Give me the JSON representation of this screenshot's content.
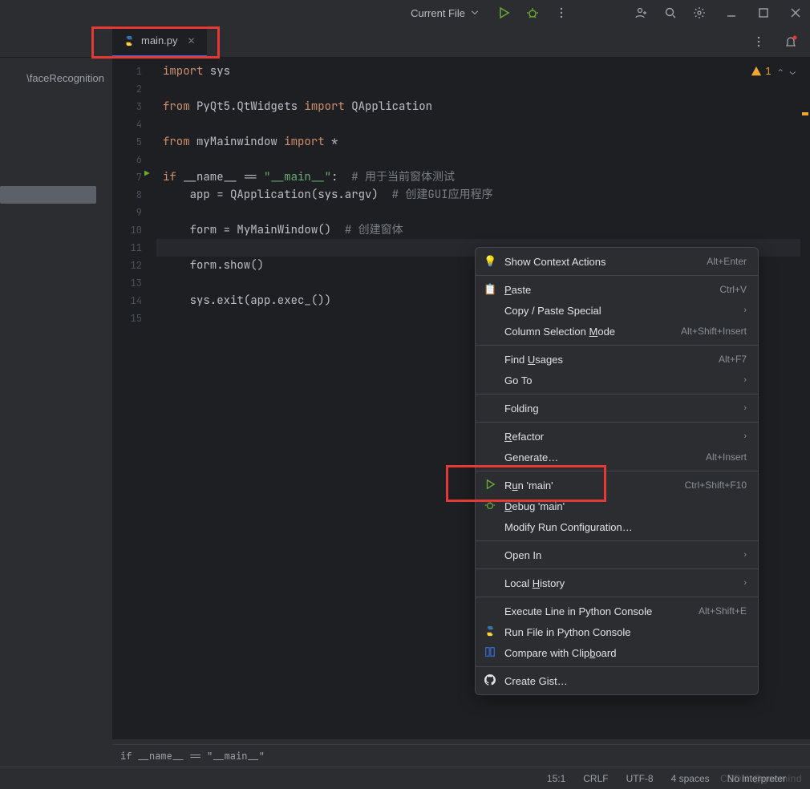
{
  "topbar": {
    "run_config": "Current File",
    "icons": [
      "run",
      "debug",
      "more",
      "collab",
      "search",
      "settings",
      "min",
      "max",
      "close"
    ]
  },
  "tab": {
    "filename": "main.py"
  },
  "project": {
    "path_fragment": "\\faceRecognition"
  },
  "warning": {
    "count": "1"
  },
  "gutter_lines": [
    "1",
    "2",
    "3",
    "4",
    "5",
    "6",
    "7",
    "8",
    "9",
    "10",
    "11",
    "12",
    "13",
    "14",
    "15"
  ],
  "code": {
    "l1_kw": "import",
    "l1_rest": " sys",
    "l3_from": "from",
    "l3_mod": " PyQt5.QtWidgets ",
    "l3_imp": "import",
    "l3_rest": " QApplication",
    "l5_from": "from",
    "l5_mod": " myMainwindow ",
    "l5_imp": "import",
    "l5_rest": " *",
    "l7_if": "if",
    "l7_name": " __name__ ",
    "l7_eq": "==",
    "l7_str": " \"__main__\"",
    "l7_colon": ":",
    "l7_cmt": "  # 用于当前窗体测试",
    "l8_a": "    app ",
    "l8_eq": "=",
    "l8_b": " QApplication(sys.argv)  ",
    "l8_cmt": "# 创建GUI应用程序",
    "l10_a": "    form ",
    "l10_eq": "=",
    "l10_b": " MyMainWindow()  ",
    "l10_cmt": "# 创建窗体",
    "l12": "    form.show()",
    "l14": "    sys.exit(app.exec_())"
  },
  "context_menu": {
    "show_context": "Show Context Actions",
    "show_context_sc": "Alt+Enter",
    "paste": "aste",
    "paste_u": "P",
    "paste_sc": "Ctrl+V",
    "copy_special": "Copy / Paste Special",
    "col_sel_a": "Column Selection ",
    "col_sel_u": "M",
    "col_sel_b": "ode",
    "col_sel_sc": "Alt+Shift+Insert",
    "find_a": "Find ",
    "find_u": "U",
    "find_b": "sages",
    "find_sc": "Alt+F7",
    "goto": "Go To",
    "folding": "Folding",
    "refactor_u": "R",
    "refactor_b": "efactor",
    "generate": "Generate…",
    "generate_sc": "Alt+Insert",
    "run_a": "R",
    "run_u": "u",
    "run_b": "n 'main'",
    "run_sc": "Ctrl+Shift+F10",
    "debug_u": "D",
    "debug_b": "ebug 'main'",
    "modify_run": "Modify Run Configuration…",
    "open_in": "Open In",
    "local_a": "Local ",
    "local_u": "H",
    "local_b": "istory",
    "exec_console": "Execute Line in Python Console",
    "exec_sc": "Alt+Shift+E",
    "run_file_console": "Run File in Python Console",
    "compare_a": "Compare with Clip",
    "compare_u": "b",
    "compare_b": "oard",
    "create_gist": "Create Gist…"
  },
  "breadcrumb": "if __name__ == \"__main__\"",
  "statusbar": {
    "pos": "15:1",
    "sep": "CRLF",
    "enc": "UTF-8",
    "indent": "4 spaces",
    "interp": "No interpreter"
  },
  "watermark": "CSDN @gonmind"
}
